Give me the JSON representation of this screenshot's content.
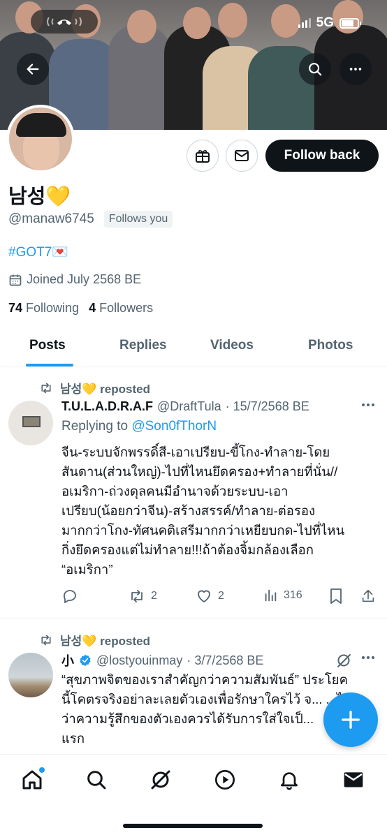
{
  "status_bar": {
    "network": "5G",
    "battery_percent": 75
  },
  "profile": {
    "name": "남성💛",
    "handle": "@manaw6745",
    "follows_you": "Follows you",
    "bio": "#GOT7💌",
    "joined": "Joined July 2568 BE",
    "following_count": "74",
    "following_label": "Following",
    "followers_count": "4",
    "followers_label": "Followers",
    "follow_back_label": "Follow back"
  },
  "tabs": [
    {
      "label": "Posts",
      "active": true
    },
    {
      "label": "Replies",
      "active": false
    },
    {
      "label": "Videos",
      "active": false
    },
    {
      "label": "Photos",
      "active": false
    }
  ],
  "posts": [
    {
      "repost_label": "남성💛 reposted",
      "author": "T.U.L.A.D.R.A.F",
      "handle": "@DraftTula",
      "date": "· 15/7/2568 BE",
      "reply_prefix": "Replying to ",
      "reply_handle": "@Son0fThorN",
      "lines": [
        "จีน-ระบบจักพรรดิ์สี-เอาเปรียบ-ขี้โกง-ทำลาย-โดย",
        "สันดาน(ส่วนใหญ่)-ไปที่ไหนยึดครอง+ทำลายที่นั่น//",
        "อเมริกา-ถ่วงดุลคนมีอำนาจด้วยระบบ-เอา",
        "เปรียบ(น้อยกว่าจีน)-สร้างสรรค์/ทำลาย-ต่อรอง",
        "มากกว่าโกง-ทัศนคติเสรีมากกว่าเหยียบกด-ไปที่ไหน",
        "กิ่งยึดครองแต่ไม่ทำลาย!!!ถ้าต้องจิ้มกล้องเลือก",
        "“อเมริกา”"
      ],
      "retweets": "2",
      "likes": "2",
      "views": "316"
    },
    {
      "repost_label": "남성💛 reposted",
      "author": "小",
      "handle": "@lostyouinmay",
      "date": "· 3/7/2568 BE",
      "lines": [
        "“สุขภาพจิตของเราสำคัญกว่าความสัมพันธ์” ประโยค",
        "นี้โคตรจริงอย่าละเลยตัวเองเพื่อรักษาใครไว้ จ... ...ไป",
        "ว่าความรู้สึกของตัวเองควรได้รับการใส่ใจเป็...",
        "แรก"
      ]
    }
  ],
  "colors": {
    "accent": "#1d9bf0",
    "text": "#0f1419",
    "muted": "#536471"
  },
  "icons": {
    "back": "arrow-left-icon",
    "search": "search-icon",
    "more": "more-icon",
    "gift": "gift-icon",
    "message": "envelope-icon",
    "calendar": "calendar-icon",
    "repost": "repost-icon",
    "reply": "reply-icon",
    "like": "heart-icon",
    "views": "views-icon",
    "bookmark": "bookmark-icon",
    "share": "share-icon",
    "compose": "plus-icon",
    "verified": "verified-badge-icon",
    "grok": "grok-icon",
    "nav_home": "home-icon",
    "nav_search": "search-icon",
    "nav_grok": "grok-icon",
    "nav_video": "play-icon",
    "nav_notifications": "bell-icon",
    "nav_messages": "mail-icon"
  }
}
